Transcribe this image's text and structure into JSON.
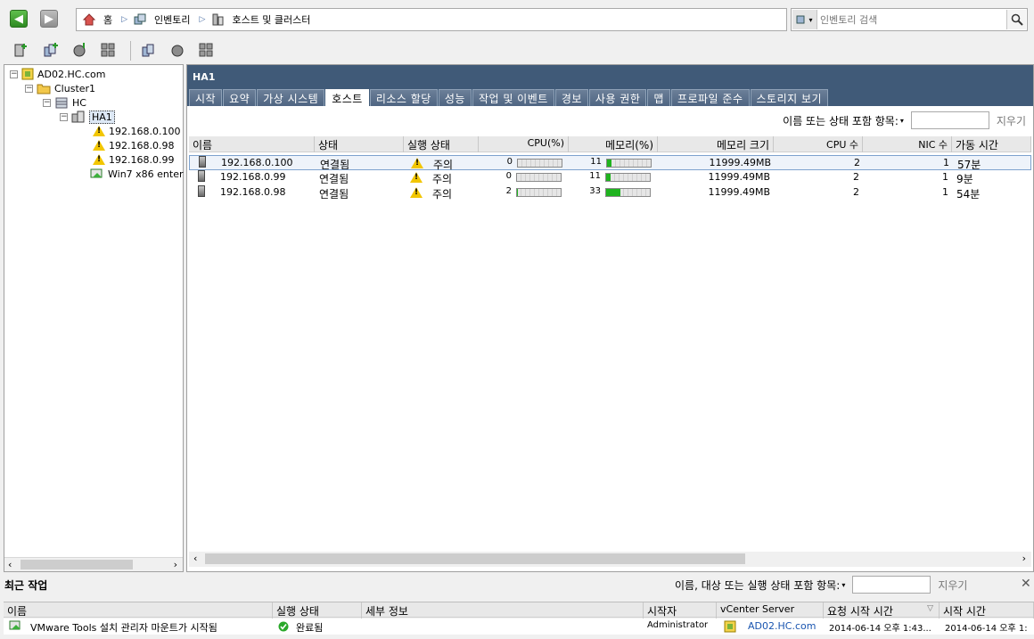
{
  "nav": {
    "breadcrumbs": [
      "홈",
      "인벤토리",
      "호스트 및 클러스터"
    ],
    "search_placeholder": "인벤토리 검색"
  },
  "tree": {
    "root": "AD02.HC.com",
    "cluster": "Cluster1",
    "datacenter": "HC",
    "ha": "HA1",
    "hosts": [
      "192.168.0.100",
      "192.168.0.98",
      "192.168.0.99"
    ],
    "vm": "Win7 x86 enter"
  },
  "panel": {
    "title": "HA1",
    "tabs": [
      "시작",
      "요약",
      "가상 시스템",
      "호스트",
      "리소스 할당",
      "성능",
      "작업 및 이벤트",
      "경보",
      "사용 권한",
      "맵",
      "프로파일 준수",
      "스토리지 보기"
    ],
    "active_tab": "호스트",
    "filter_label": "이름 또는 상태 포함 항목:",
    "clear": "지우기"
  },
  "grid": {
    "columns": [
      "이름",
      "상태",
      "실행 상태",
      "CPU(%)",
      "메모리(%)",
      "메모리 크기",
      "CPU 수",
      "NIC 수",
      "가동 시간"
    ],
    "rows": [
      {
        "name": "192.168.0.100",
        "state": "연결됨",
        "status": "주의",
        "cpu": "0",
        "mem": "11",
        "mem_size": "11999.49MB",
        "cpus": "2",
        "nics": "1",
        "uptime": "57분",
        "cpu_pct": 0,
        "mem_pct": 11
      },
      {
        "name": "192.168.0.99",
        "state": "연결됨",
        "status": "주의",
        "cpu": "0",
        "mem": "11",
        "mem_size": "11999.49MB",
        "cpus": "2",
        "nics": "1",
        "uptime": "9분",
        "cpu_pct": 0,
        "mem_pct": 11
      },
      {
        "name": "192.168.0.98",
        "state": "연결됨",
        "status": "주의",
        "cpu": "2",
        "mem": "33",
        "mem_size": "11999.49MB",
        "cpus": "2",
        "nics": "1",
        "uptime": "54분",
        "cpu_pct": 2,
        "mem_pct": 33
      }
    ]
  },
  "tasks": {
    "title": "최근 작업",
    "filter_label": "이름, 대상 또는 실행 상태 포함 항목:",
    "clear": "지우기",
    "close": "✕",
    "columns": [
      "이름",
      "실행 상태",
      "세부 정보",
      "시작자",
      "vCenter Server",
      "요청 시작 시간",
      "시작 시간"
    ],
    "row": {
      "name": "VMware Tools 설치 관리자 마운트가 시작됨",
      "status": "완료됨",
      "details": "",
      "initiator": "Administrator",
      "vcenter": "AD02.HC.com",
      "requested": "2014-06-14 오후 1:43...",
      "start": "2014-06-14 오후 1:"
    }
  },
  "colors": {
    "header": "#405a78",
    "bar_fill": "#1fb31f",
    "link": "#1a55b0"
  }
}
